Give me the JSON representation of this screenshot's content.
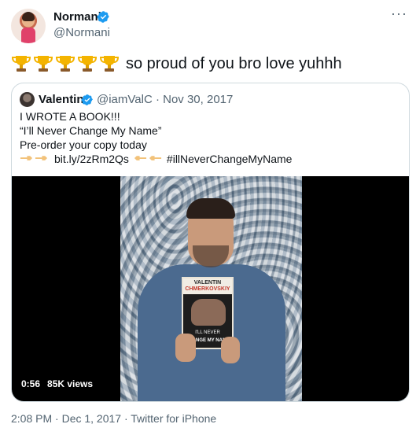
{
  "author": {
    "name": "Normani",
    "handle": "@Normani"
  },
  "tweet": {
    "trophy_icon": "trophy-icon",
    "trophy_count": 5,
    "text": "so proud of you bro love yuhhh"
  },
  "quote": {
    "name": "Valentin",
    "handle": "@iamValC",
    "date": "Nov 30, 2017",
    "meta": "@iamValC · Nov 30, 2017",
    "lines": [
      "I WROTE A BOOK!!!",
      "“I’ll Never Change My Name”",
      "Pre-order your copy today"
    ],
    "link": "bit.ly/2zRm2Qs",
    "hashtag": "#illNeverChangeMyName",
    "video": {
      "duration": "0:56",
      "views": "85K views",
      "book_author": "VALENTIN CHMERKOVSKIY",
      "book_title": "I'LL NEVER CHANGE MY NAME"
    }
  },
  "footer": {
    "timestamp": "2:08 PM · Dec 1, 2017 · Twitter for iPhone"
  },
  "colors": {
    "verified": "#1d9bf0",
    "secondary_text": "#536471",
    "border": "#cfd9de",
    "trophy": "#f4b400"
  }
}
